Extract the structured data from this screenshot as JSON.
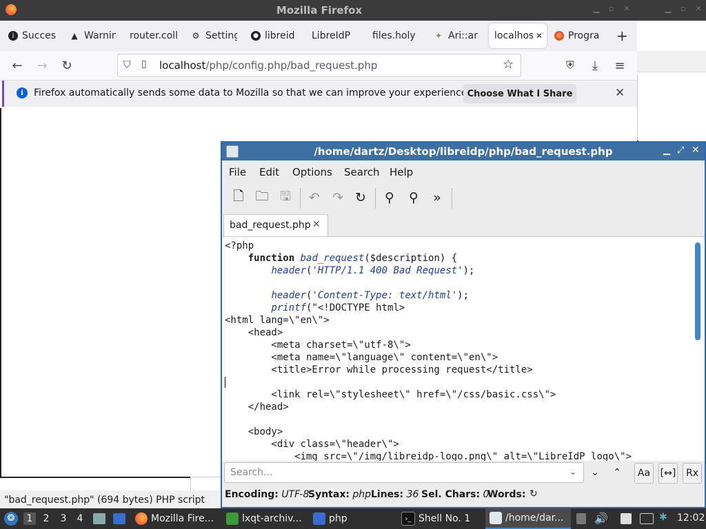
{
  "firefox": {
    "window_title": "Mozilla Firefox",
    "tabs": [
      {
        "label": "Succes",
        "icon": "info-icon"
      },
      {
        "label": "Warnin",
        "icon": "warning-icon"
      },
      {
        "label": "router.coll",
        "icon": ""
      },
      {
        "label": "Setting",
        "icon": "gear-icon"
      },
      {
        "label": "libreid",
        "icon": "github-icon"
      },
      {
        "label": "LibreIdP",
        "icon": ""
      },
      {
        "label": "files.holy",
        "icon": ""
      },
      {
        "label": "Ari::ar",
        "icon": "bird-icon"
      },
      {
        "label": "localhos",
        "icon": ""
      },
      {
        "label": "Progra",
        "icon": "ubuntu-icon"
      }
    ],
    "new_tab": "+",
    "url_host": "localhost",
    "url_path": "/php/config.php/bad_request.php",
    "notification": {
      "text": "Firefox automatically sends some data to Mozilla so that we can improve your experience.",
      "button": "Choose What I Share"
    },
    "status_text": "\"bad_request.php\" (694 bytes) PHP script"
  },
  "featherpad": {
    "title": "/home/dartz/Desktop/libreidp/php/bad_request.php",
    "menu": [
      "File",
      "Edit",
      "Options",
      "Search",
      "Help"
    ],
    "tab_label": "bad_request.php",
    "search_placeholder": "Search...",
    "status": {
      "encoding_label": "Encoding:",
      "encoding_value": "UTF-8",
      "syntax_label": "Syntax:",
      "syntax_value": "php",
      "lines_label": "Lines:",
      "lines_value": "36",
      "sel_label": "Sel. Chars:",
      "sel_value": "0",
      "words_label": "Words:"
    },
    "code_lines": [
      "<?php",
      "    function bad_request($description) {",
      "        header('HTTP/1.1 400 Bad Request');",
      "",
      "        header('Content-Type: text/html');",
      "        printf(\"<!DOCTYPE html>",
      "<html lang=\\\"en\\\">",
      "    <head>",
      "        <meta charset=\\\"utf-8\\\">",
      "        <meta name=\\\"language\\\" content=\\\"en\\\">",
      "        <title>Error while processing request</title>",
      "",
      "        <link rel=\\\"stylesheet\\\" href=\\\"/css/basic.css\\\">",
      "    </head>",
      "",
      "    <body>",
      "        <div class=\\\"header\\\">",
      "            <img src=\\\"/img/libreidp-logo.png\\\" alt=\\\"LibreIdP logo\\\">"
    ]
  },
  "taskbar": {
    "desktops": [
      "1",
      "2",
      "3",
      "4"
    ],
    "items": [
      {
        "label": "Mozilla Fire...",
        "icon": "firefox-icon"
      },
      {
        "label": "lxqt-archiv...",
        "icon": "archive-icon"
      },
      {
        "label": "php",
        "icon": "folder-icon"
      },
      {
        "label": "Shell No. 1",
        "icon": "terminal-icon"
      },
      {
        "label": "/home/dar...",
        "icon": "editor-icon"
      }
    ],
    "clock": "12:02"
  },
  "colors": {
    "accent": "#3d6fa3",
    "firefox_accent": "#7542e5",
    "taskbar": "#2f2f2f"
  }
}
